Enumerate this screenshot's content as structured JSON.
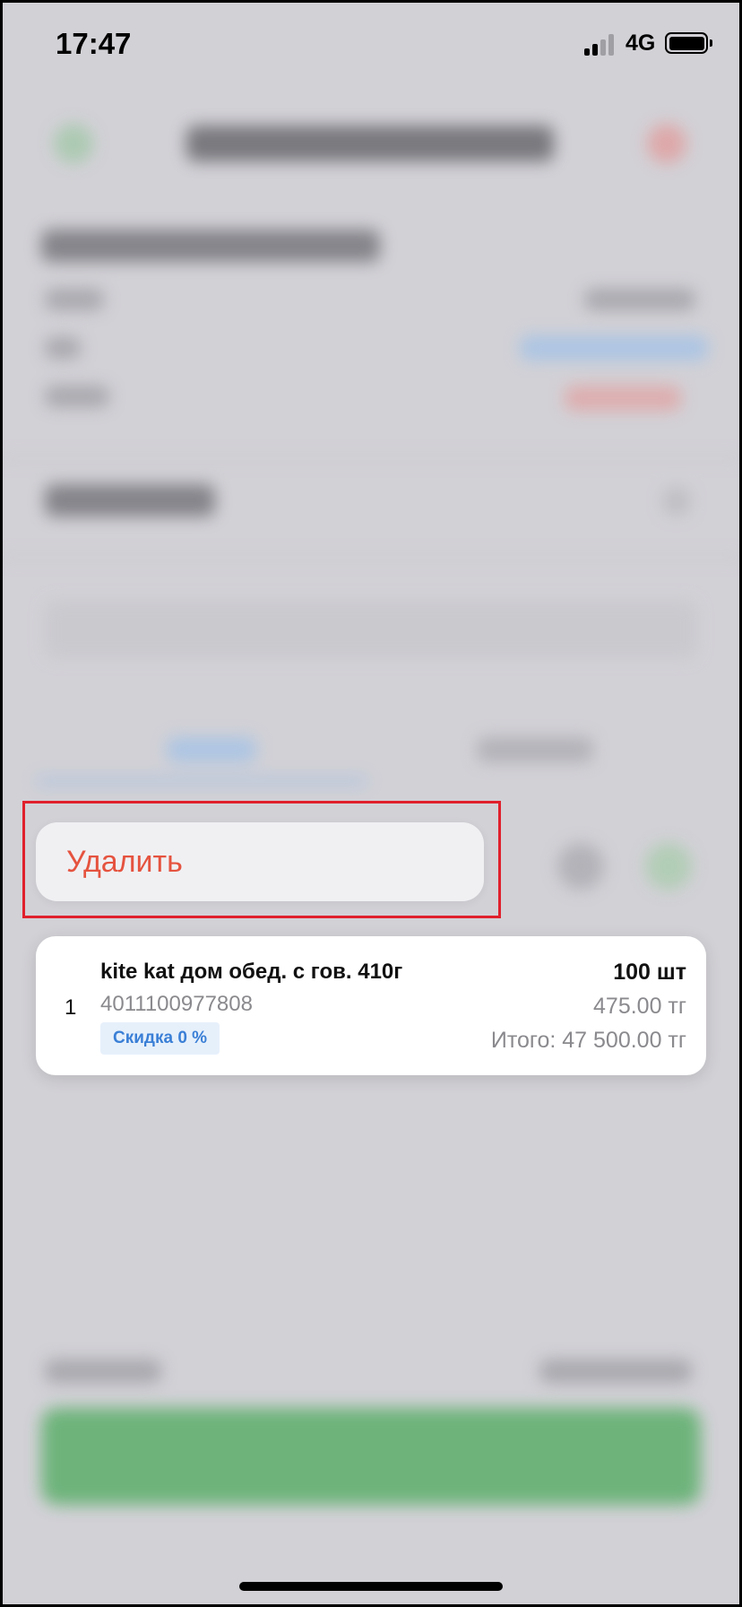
{
  "status_bar": {
    "time": "17:47",
    "network": "4G",
    "signal_bars_active": 2,
    "signal_bars_total": 4,
    "battery_level": 1.0
  },
  "context_menu": {
    "delete_label": "Удалить",
    "delete_color": "#e5533f",
    "highlight_color": "#e0202c"
  },
  "item_card": {
    "index": "1",
    "name": "kite kat дом обед. с гов. 410г",
    "barcode": "4011100977808",
    "discount": "Скидка 0 %",
    "quantity": "100 шт",
    "price": "475.00 тг",
    "total": "Итого: 47 500.00 тг"
  },
  "colors": {
    "primary_green": "#4caa5c",
    "link_blue": "#3a7fd6",
    "danger_red": "#e5533f"
  }
}
